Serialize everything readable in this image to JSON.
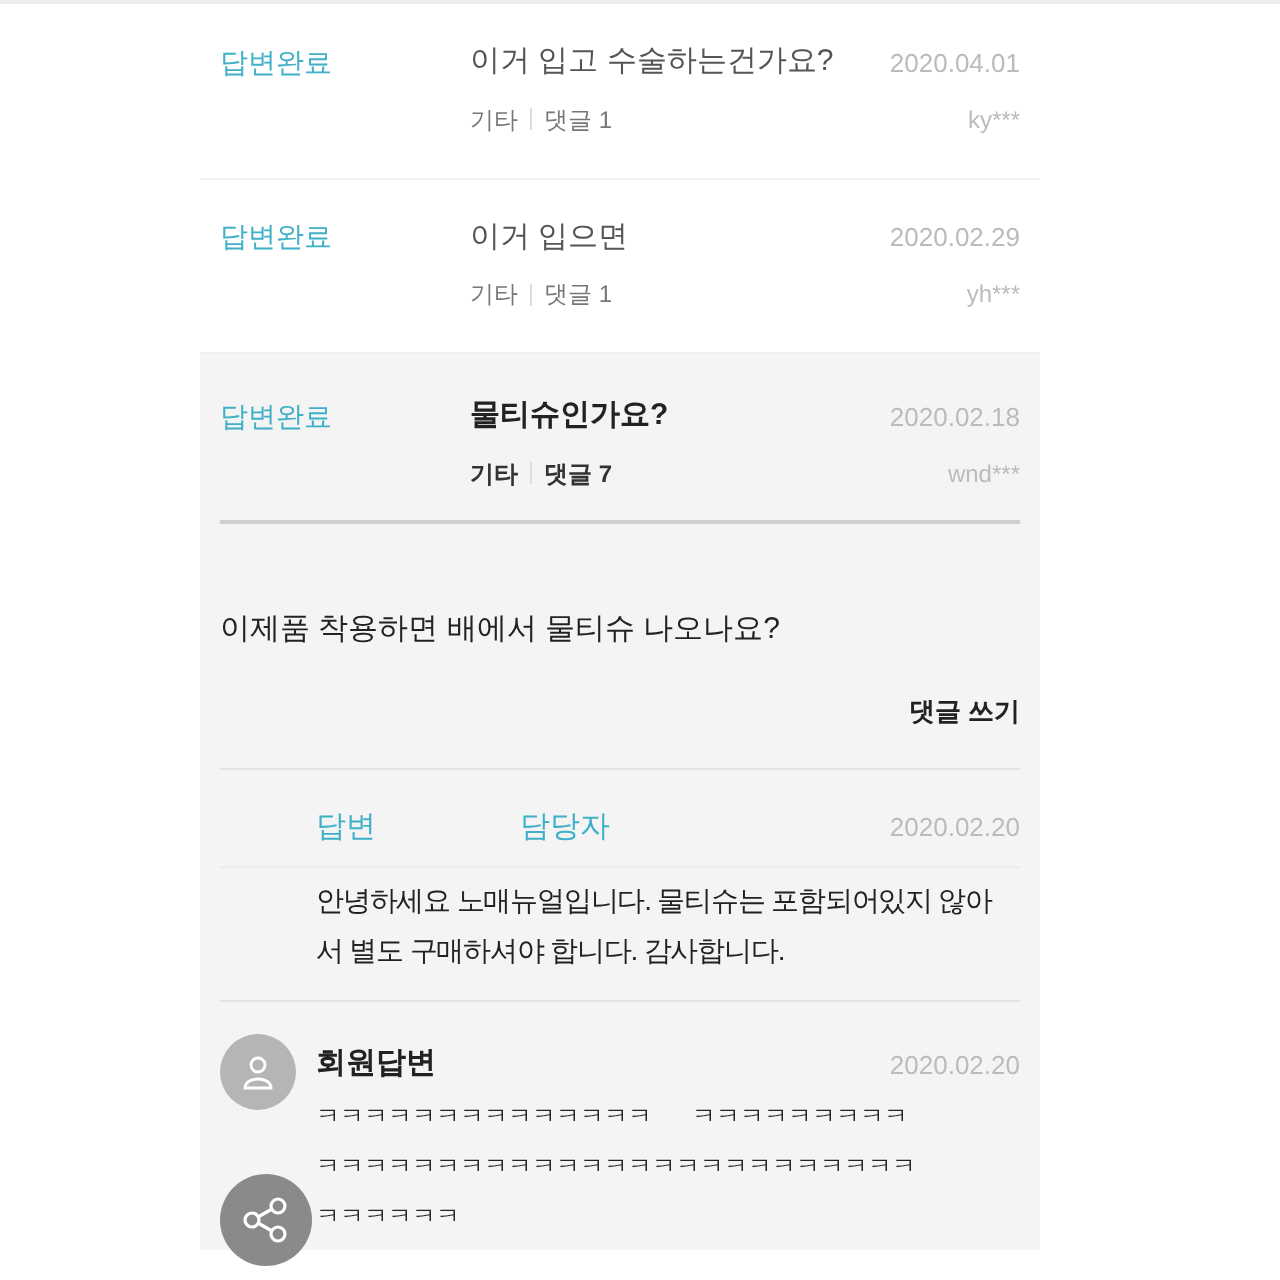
{
  "questions": [
    {
      "status": "답변완료",
      "title": "이거 입고 수술하는건가요?",
      "category": "기타",
      "comments": "댓글 1",
      "date": "2020.04.01",
      "author": "ky***",
      "selected": false
    },
    {
      "status": "답변완료",
      "title": "이거 입으면",
      "category": "기타",
      "comments": "댓글 1",
      "date": "2020.02.29",
      "author": "yh***",
      "selected": false
    },
    {
      "status": "답변완료",
      "title": "물티슈인가요?",
      "category": "기타",
      "comments": "댓글 7",
      "date": "2020.02.18",
      "author": "wnd***",
      "selected": true
    }
  ],
  "detail": {
    "question": "이제품 착용하면 배에서 물티슈 나오나요?",
    "write_comment": "댓글 쓰기",
    "answers": [
      {
        "kind": "staff",
        "label": "답변",
        "author": "담당자",
        "date": "2020.02.20",
        "lines": [
          "안녕하세요 노매뉴얼입니다. 물티슈는 포함되어있지 않아",
          "서 별도 구매하셔야 합니다. 감사합니다."
        ]
      },
      {
        "kind": "member",
        "label": "회원답변",
        "date": "2020.02.20",
        "lines": [
          "ㅋㅋㅋㅋㅋㅋㅋㅋㅋㅋㅋㅋㅋㅋ      ㅋㅋㅋㅋㅋㅋㅋㅋㅋ",
          "ㅋㅋㅋㅋㅋㅋㅋㅋㅋㅋㅋㅋㅋㅋㅋㅋㅋㅋㅋㅋㅋㅋㅋㅋㅋ",
          "ㅋㅋㅋㅋㅋㅋ"
        ]
      }
    ]
  }
}
